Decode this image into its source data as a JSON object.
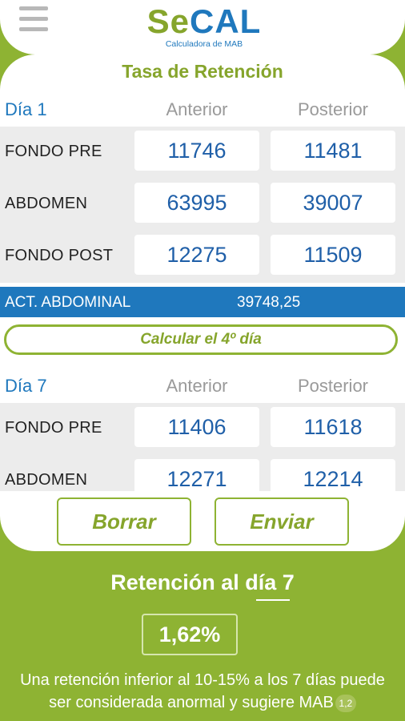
{
  "header": {
    "logo_se": "Se",
    "logo_cal": "CAL",
    "logo_subtitle": "Calculadora de MAB",
    "menu_icon": "hamburger-menu-icon"
  },
  "title": "Tasa de Retención",
  "columns": {
    "before": "Anterior",
    "after": "Posterior"
  },
  "day1": {
    "label": "Día 1",
    "rows": [
      {
        "label": "FONDO PRE",
        "before": "11746",
        "after": "11481"
      },
      {
        "label": "ABDOMEN",
        "before": "63995",
        "after": "39007"
      },
      {
        "label": "FONDO POST",
        "before": "12275",
        "after": "11509"
      }
    ]
  },
  "activity": {
    "label": "ACT. ABDOMINAL",
    "value": "39748,25"
  },
  "calc_button": "Calcular el 4º día",
  "day7": {
    "label": "Día 7",
    "rows": [
      {
        "label": "FONDO PRE",
        "before": "11406",
        "after": "11618"
      },
      {
        "label": "ABDOMEN",
        "before": "12271",
        "after": "12214"
      }
    ]
  },
  "buttons": {
    "clear": "Borrar",
    "send": "Enviar"
  },
  "result": {
    "title_prefix": "Retención  al día ",
    "day": "7",
    "value": "1,62%"
  },
  "note": {
    "line1": "Una retención inferior al 10-15% a los 7 días puede",
    "line2": "ser considerada anormal y sugiere MAB",
    "ref": "1,2"
  },
  "colors": {
    "brand_green": "#8eb333",
    "brand_blue": "#1f78bd"
  }
}
